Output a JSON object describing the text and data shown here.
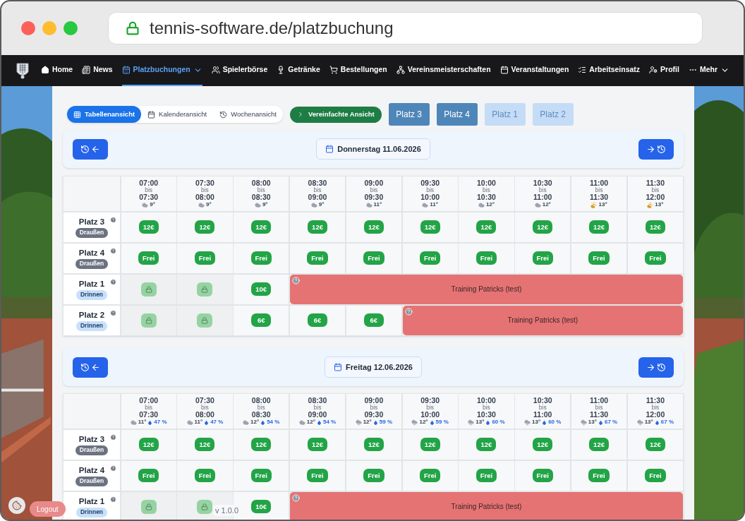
{
  "browser": {
    "url": "tennis-software.de/platzbuchung"
  },
  "nav": [
    {
      "label": "Home",
      "selected": false,
      "dropdown": false
    },
    {
      "label": "News",
      "selected": false,
      "dropdown": false
    },
    {
      "label": "Platzbuchungen",
      "selected": true,
      "dropdown": true
    },
    {
      "label": "Spielerbörse",
      "selected": false,
      "dropdown": false
    },
    {
      "label": "Getränke",
      "selected": false,
      "dropdown": false
    },
    {
      "label": "Bestellungen",
      "selected": false,
      "dropdown": false
    },
    {
      "label": "Vereinsmeisterschaften",
      "selected": false,
      "dropdown": false
    },
    {
      "label": "Veranstaltungen",
      "selected": false,
      "dropdown": false
    },
    {
      "label": "Arbeitseinsatz",
      "selected": false,
      "dropdown": false
    },
    {
      "label": "Profil",
      "selected": false,
      "dropdown": false
    },
    {
      "label": "Mehr",
      "selected": false,
      "dropdown": true
    }
  ],
  "view_tabs": [
    {
      "label": "Tabellenansicht",
      "selected": true
    },
    {
      "label": "Kalenderansicht",
      "selected": false
    },
    {
      "label": "Wochenansicht",
      "selected": false
    }
  ],
  "simplified_button": "Vereinfachte Ansicht",
  "court_filters": [
    {
      "label": "Platz 3",
      "selected": true
    },
    {
      "label": "Platz 4",
      "selected": true
    },
    {
      "label": "Platz 1",
      "selected": false
    },
    {
      "label": "Platz 2",
      "selected": false
    }
  ],
  "days": [
    {
      "date": "Donnerstag 11.06.2026",
      "slots": [
        {
          "from": "07:00",
          "bis": "bis",
          "to": "07:30",
          "kind": "cloudy",
          "temp": "9°"
        },
        {
          "from": "07:30",
          "bis": "bis",
          "to": "08:00",
          "kind": "cloudy",
          "temp": "9°"
        },
        {
          "from": "08:00",
          "bis": "bis",
          "to": "08:30",
          "kind": "cloudy",
          "temp": "9°"
        },
        {
          "from": "08:30",
          "bis": "bis",
          "to": "09:00",
          "kind": "cloudy",
          "temp": "9°"
        },
        {
          "from": "09:00",
          "bis": "bis",
          "to": "09:30",
          "kind": "cloudy",
          "temp": "11°"
        },
        {
          "from": "09:30",
          "bis": "bis",
          "to": "10:00",
          "kind": "cloudy",
          "temp": "11°"
        },
        {
          "from": "10:00",
          "bis": "bis",
          "to": "10:30",
          "kind": "cloudy",
          "temp": "12°"
        },
        {
          "from": "10:30",
          "bis": "bis",
          "to": "11:00",
          "kind": "cloudy",
          "temp": "12°"
        },
        {
          "from": "11:00",
          "bis": "bis",
          "to": "11:30",
          "kind": "sunny",
          "temp": "13°"
        },
        {
          "from": "11:30",
          "bis": "bis",
          "to": "12:00",
          "kind": "sunny",
          "temp": "13°"
        }
      ],
      "courts": [
        {
          "name": "Platz 3",
          "location": "Draußen",
          "kind": "outdoor",
          "cells": [
            {
              "kind": "price",
              "label": "12€"
            },
            {
              "kind": "price",
              "label": "12€"
            },
            {
              "kind": "price",
              "label": "12€"
            },
            {
              "kind": "price",
              "label": "12€"
            },
            {
              "kind": "price",
              "label": "12€"
            },
            {
              "kind": "price",
              "label": "12€"
            },
            {
              "kind": "price",
              "label": "12€"
            },
            {
              "kind": "price",
              "label": "12€"
            },
            {
              "kind": "price",
              "label": "12€"
            },
            {
              "kind": "price",
              "label": "12€"
            }
          ]
        },
        {
          "name": "Platz 4",
          "location": "Draußen",
          "kind": "outdoor",
          "cells": [
            {
              "kind": "price",
              "label": "Frei"
            },
            {
              "kind": "price",
              "label": "Frei"
            },
            {
              "kind": "price",
              "label": "Frei"
            },
            {
              "kind": "price",
              "label": "Frei"
            },
            {
              "kind": "price",
              "label": "Frei"
            },
            {
              "kind": "price",
              "label": "Frei"
            },
            {
              "kind": "price",
              "label": "Frei"
            },
            {
              "kind": "price",
              "label": "Frei"
            },
            {
              "kind": "price",
              "label": "Frei"
            },
            {
              "kind": "price",
              "label": "Frei"
            }
          ]
        },
        {
          "name": "Platz 1",
          "location": "Drinnen",
          "kind": "indoor",
          "cells": [
            {
              "kind": "locked"
            },
            {
              "kind": "locked"
            },
            {
              "kind": "price",
              "label": "10€"
            },
            {
              "kind": "booking",
              "title": "Training Patricks (test)"
            },
            {
              "kind": "booking"
            },
            {
              "kind": "booking"
            },
            {
              "kind": "booking"
            },
            {
              "kind": "booking"
            },
            {
              "kind": "booking"
            },
            {
              "kind": "booking"
            }
          ]
        },
        {
          "name": "Platz 2",
          "location": "Drinnen",
          "kind": "indoor",
          "cells": [
            {
              "kind": "locked"
            },
            {
              "kind": "locked"
            },
            {
              "kind": "price",
              "label": "6€"
            },
            {
              "kind": "price",
              "label": "6€"
            },
            {
              "kind": "price",
              "label": "6€"
            },
            {
              "kind": "booking",
              "title": "Training Patricks (test)"
            },
            {
              "kind": "booking"
            },
            {
              "kind": "booking"
            },
            {
              "kind": "booking"
            },
            {
              "kind": "booking"
            }
          ]
        }
      ]
    },
    {
      "date": "Freitag 12.06.2026",
      "slots": [
        {
          "from": "07:00",
          "bis": "bis",
          "to": "07:30",
          "kind": "cloudy",
          "temp": "11°",
          "rain": "47 %"
        },
        {
          "from": "07:30",
          "bis": "bis",
          "to": "08:00",
          "kind": "cloudy",
          "temp": "11°",
          "rain": "47 %"
        },
        {
          "from": "08:00",
          "bis": "bis",
          "to": "08:30",
          "kind": "cloudy",
          "temp": "12°",
          "rain": "54 %"
        },
        {
          "from": "08:30",
          "bis": "bis",
          "to": "09:00",
          "kind": "cloudy",
          "temp": "12°",
          "rain": "54 %"
        },
        {
          "from": "09:00",
          "bis": "bis",
          "to": "09:30",
          "kind": "rain",
          "temp": "12°",
          "rain": "59 %"
        },
        {
          "from": "09:30",
          "bis": "bis",
          "to": "10:00",
          "kind": "rain",
          "temp": "12°",
          "rain": "59 %"
        },
        {
          "from": "10:00",
          "bis": "bis",
          "to": "10:30",
          "kind": "rain",
          "temp": "13°",
          "rain": "60 %"
        },
        {
          "from": "10:30",
          "bis": "bis",
          "to": "11:00",
          "kind": "rain",
          "temp": "13°",
          "rain": "60 %"
        },
        {
          "from": "11:00",
          "bis": "bis",
          "to": "11:30",
          "kind": "rain",
          "temp": "13°",
          "rain": "67 %"
        },
        {
          "from": "11:30",
          "bis": "bis",
          "to": "12:00",
          "kind": "rain",
          "temp": "13°",
          "rain": "67 %"
        }
      ],
      "courts": [
        {
          "name": "Platz 3",
          "location": "Draußen",
          "kind": "outdoor",
          "cells": [
            {
              "kind": "price",
              "label": "12€"
            },
            {
              "kind": "price",
              "label": "12€"
            },
            {
              "kind": "price",
              "label": "12€"
            },
            {
              "kind": "price",
              "label": "12€"
            },
            {
              "kind": "price",
              "label": "12€"
            },
            {
              "kind": "price",
              "label": "12€"
            },
            {
              "kind": "price",
              "label": "12€"
            },
            {
              "kind": "price",
              "label": "12€"
            },
            {
              "kind": "price",
              "label": "12€"
            },
            {
              "kind": "price",
              "label": "12€"
            }
          ]
        },
        {
          "name": "Platz 4",
          "location": "Draußen",
          "kind": "outdoor",
          "cells": [
            {
              "kind": "price",
              "label": "Frei"
            },
            {
              "kind": "price",
              "label": "Frei"
            },
            {
              "kind": "price",
              "label": "Frei"
            },
            {
              "kind": "price",
              "label": "Frei"
            },
            {
              "kind": "price",
              "label": "Frei"
            },
            {
              "kind": "price",
              "label": "Frei"
            },
            {
              "kind": "price",
              "label": "Frei"
            },
            {
              "kind": "price",
              "label": "Frei"
            },
            {
              "kind": "price",
              "label": "Frei"
            },
            {
              "kind": "price",
              "label": "Frei"
            }
          ]
        },
        {
          "name": "Platz 1",
          "location": "Drinnen",
          "kind": "indoor",
          "cells": [
            {
              "kind": "locked"
            },
            {
              "kind": "locked"
            },
            {
              "kind": "price",
              "label": "10€"
            },
            {
              "kind": "booking",
              "title": "Training Patricks (test)"
            },
            {
              "kind": "booking"
            },
            {
              "kind": "booking"
            },
            {
              "kind": "booking"
            },
            {
              "kind": "booking"
            },
            {
              "kind": "booking"
            },
            {
              "kind": "booking"
            }
          ]
        }
      ]
    }
  ],
  "footer": {
    "logout": "Logout",
    "version": "v 1.0.0"
  }
}
